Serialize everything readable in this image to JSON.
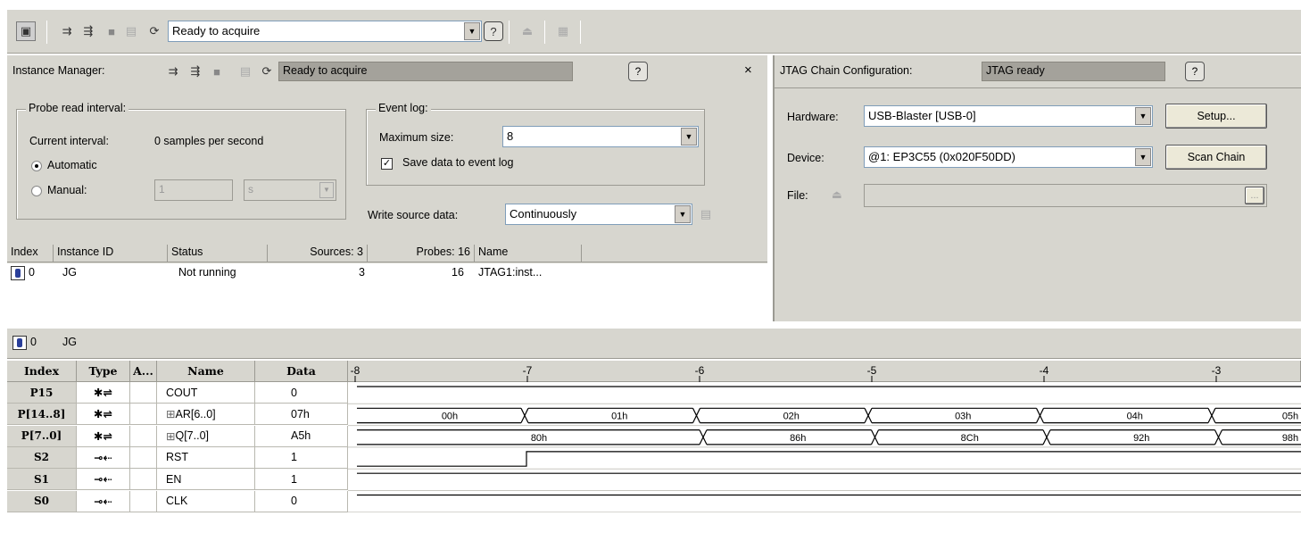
{
  "toolbar": {
    "status_combo": "Ready to acquire",
    "help": "?"
  },
  "instance_manager": {
    "label": "Instance Manager:",
    "status": "Ready to acquire",
    "help": "?",
    "close": "×",
    "probe_group": {
      "title": "Probe read interval:",
      "current_label": "Current interval:",
      "current_value": "0 samples per second",
      "automatic": "Automatic",
      "manual": "Manual:",
      "manual_value": "1",
      "manual_unit": "s",
      "automatic_selected": true
    },
    "event_log": {
      "title": "Event log:",
      "max_size_label": "Maximum size:",
      "max_size_value": "8",
      "save_label": "Save data to event log",
      "save_checked": true
    },
    "write_source": {
      "label": "Write source data:",
      "value": "Continuously"
    },
    "table": {
      "columns": [
        "Index",
        "Instance ID",
        "Status",
        "Sources: 3",
        "Probes: 16",
        "Name"
      ],
      "rows": [
        {
          "index": "0",
          "instance_id": "JG",
          "status": "Not running",
          "sources": "3",
          "probes": "16",
          "name": "JTAG1:inst..."
        }
      ]
    }
  },
  "jtag": {
    "label": "JTAG Chain Configuration:",
    "status": "JTAG ready",
    "help": "?",
    "hardware_label": "Hardware:",
    "hardware_value": "USB-Blaster [USB-0]",
    "setup_button": "Setup...",
    "device_label": "Device:",
    "device_value": "@1: EP3C55 (0x020F50DD)",
    "scan_button": "Scan Chain",
    "file_label": "File:",
    "browse_button": "..."
  },
  "waveform": {
    "instance_label": "0",
    "instance_name": "JG",
    "columns": [
      "Index",
      "Type",
      "A...",
      "Name",
      "Data"
    ],
    "timeline_ticks": [
      "-8",
      "-7",
      "-6",
      "-5",
      "-4",
      "-3"
    ],
    "rows": [
      {
        "index": "P15",
        "type": "probe",
        "name": "COUT",
        "data": "0",
        "expand": false
      },
      {
        "index": "P[14..8]",
        "type": "probe-bus",
        "name": "AR[6..0]",
        "data": "07h",
        "expand": true,
        "bus_values": [
          "00h",
          "01h",
          "02h",
          "03h",
          "04h",
          "05h"
        ]
      },
      {
        "index": "P[7..0]",
        "type": "probe-bus",
        "name": "Q[7..0]",
        "data": "A5h",
        "expand": true,
        "bus_values": [
          "80h",
          "86h",
          "8Ch",
          "92h",
          "98h"
        ]
      },
      {
        "index": "S2",
        "type": "source",
        "name": "RST",
        "data": "1",
        "expand": false
      },
      {
        "index": "S1",
        "type": "source",
        "name": "EN",
        "data": "1",
        "expand": false
      },
      {
        "index": "S0",
        "type": "source",
        "name": "CLK",
        "data": "0",
        "expand": false
      }
    ]
  }
}
